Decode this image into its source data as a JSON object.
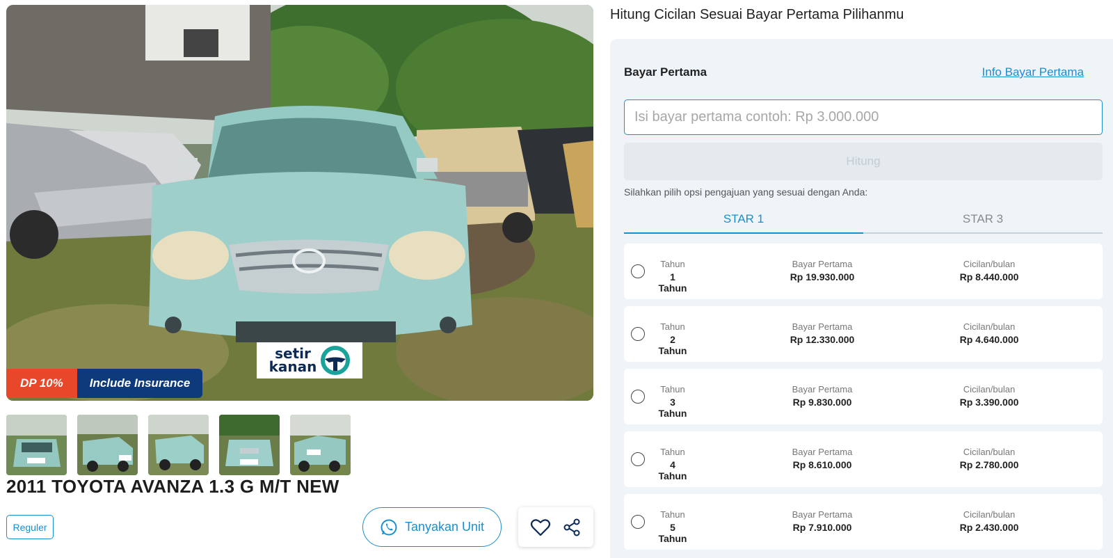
{
  "listing": {
    "badges": {
      "dp": "DP 10%",
      "insurance": "Include Insurance"
    },
    "watermark": {
      "line1": "setir",
      "line2": "kanan"
    },
    "title": "2011 TOYOTA AVANZA 1.3 G M/T NEW",
    "tag": "Reguler",
    "ask_button": "Tanyakan Unit",
    "colors": {
      "accent": "#1a8fd0",
      "dp_badge": "#e8472a",
      "insurance_badge": "#0d3a7a",
      "car_body": "#9ecfca"
    }
  },
  "calculator": {
    "heading": "Hitung Cicilan Sesuai Bayar Pertama Pilihanmu",
    "dp_label": "Bayar Pertama",
    "info_link": "Info Bayar Pertama",
    "input_placeholder": "Isi bayar pertama contoh: Rp 3.000.000",
    "calc_button": "Hitung",
    "hint": "Silahkan pilih opsi pengajuan yang sesuai dengan Anda:",
    "tabs": [
      {
        "label": "STAR 1",
        "active": true
      },
      {
        "label": "STAR 3",
        "active": false
      }
    ],
    "col_labels": {
      "tenor": "Tahun",
      "dp": "Bayar Pertama",
      "installment": "Cicilan/bulan"
    },
    "options": [
      {
        "tenor": "1 Tahun",
        "dp": "Rp 19.930.000",
        "installment": "Rp 8.440.000"
      },
      {
        "tenor": "2 Tahun",
        "dp": "Rp 12.330.000",
        "installment": "Rp 4.640.000"
      },
      {
        "tenor": "3 Tahun",
        "dp": "Rp 9.830.000",
        "installment": "Rp 3.390.000"
      },
      {
        "tenor": "4 Tahun",
        "dp": "Rp 8.610.000",
        "installment": "Rp 2.780.000"
      },
      {
        "tenor": "5 Tahun",
        "dp": "Rp 7.910.000",
        "installment": "Rp 2.430.000"
      }
    ]
  }
}
